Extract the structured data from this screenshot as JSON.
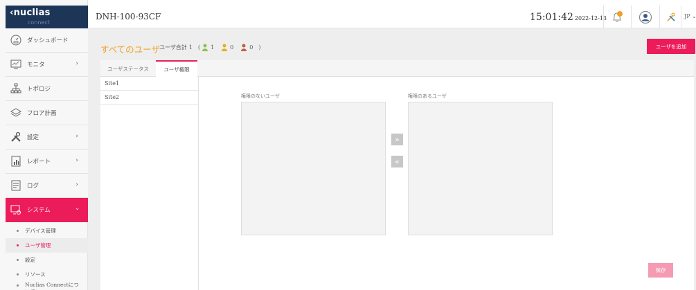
{
  "brand": {
    "logo": "nuclias",
    "logo_sub": "connect",
    "color": "#1d3658",
    "accent": "#ec1b5a"
  },
  "topbar": {
    "device_name": "DNH-100-93CF",
    "time": "15:01:42",
    "date": "2022-12-13",
    "language": "JP",
    "icons": [
      "bell-icon",
      "user-profile-icon",
      "tools-icon"
    ],
    "notification_color": "#f0a024"
  },
  "sidebar": {
    "items": [
      {
        "label": "ダッシュボード",
        "icon": "dashboard-icon"
      },
      {
        "label": "モニタ",
        "icon": "monitor-icon",
        "chevron": "›"
      },
      {
        "label": "トポロジ",
        "icon": "topology-icon"
      },
      {
        "label": "フロア計画",
        "icon": "floor-plan-icon"
      },
      {
        "label": "設定",
        "icon": "settings-tools-icon",
        "chevron": "›"
      },
      {
        "label": "レポート",
        "icon": "report-icon",
        "chevron": "›"
      },
      {
        "label": "ログ",
        "icon": "log-icon",
        "chevron": "›"
      },
      {
        "label": "システム",
        "icon": "system-icon",
        "chevron": "›",
        "active": true
      }
    ],
    "subitems": [
      {
        "label": "デバイス管理"
      },
      {
        "label": "ユーザ管理",
        "active": true
      },
      {
        "label": "設定"
      },
      {
        "label": "リソース"
      },
      {
        "label": "Nuclias Connectについて"
      }
    ]
  },
  "page": {
    "title": "すべてのユーザ",
    "summary_label": "ユーザ合計",
    "total": "1",
    "paren_open": "(",
    "paren_close": ")",
    "counts": [
      "1",
      "0",
      "0"
    ],
    "count_colors": [
      "#8bc34a",
      "#e0b020",
      "#c06040"
    ],
    "add_user_label": "ユーザを追加",
    "tabs": [
      {
        "label": "ユーザステータス"
      },
      {
        "label": "ユーザ権限",
        "active": true
      }
    ],
    "sites": [
      "Site1",
      "Site2"
    ],
    "no_permission_label": "権限のないユーザ",
    "has_permission_label": "権限のあるユーザ",
    "move_right": "»",
    "move_left": "«",
    "save_label": "保存"
  }
}
